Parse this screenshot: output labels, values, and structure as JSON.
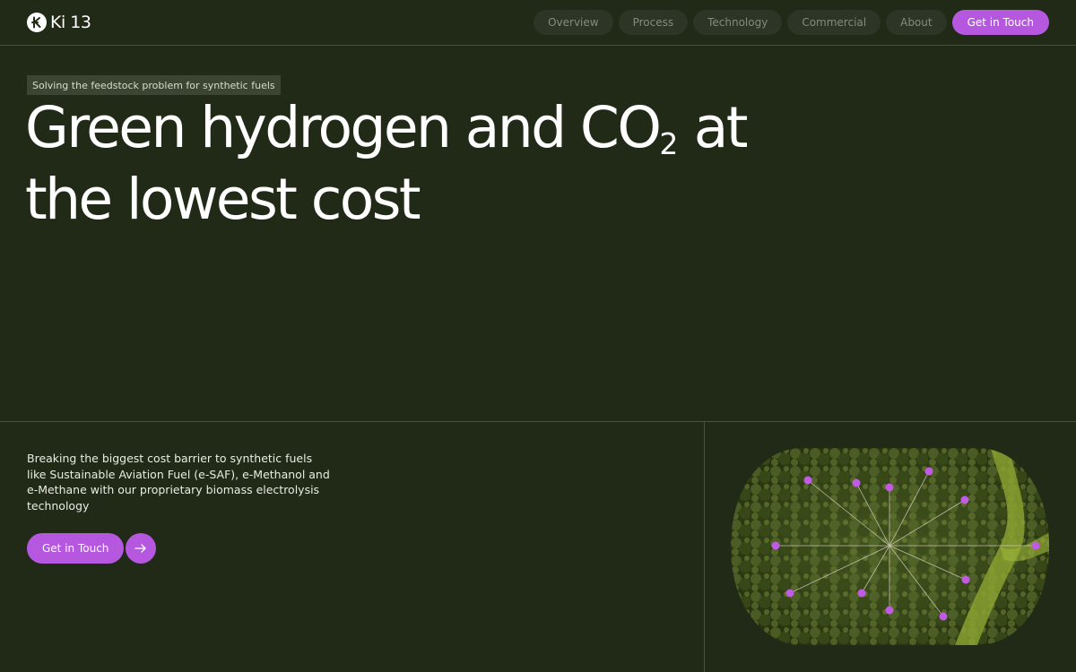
{
  "brand": {
    "name": "Ki 13",
    "logo_icon": "ki-circle-logo"
  },
  "nav": {
    "items": [
      {
        "label": "Overview"
      },
      {
        "label": "Process"
      },
      {
        "label": "Technology"
      },
      {
        "label": "Commercial"
      },
      {
        "label": "About"
      }
    ],
    "cta_label": "Get in Touch"
  },
  "hero": {
    "tagline": "Solving the feedstock problem for synthetic fuels",
    "headline_part1": "Green hydrogen and CO",
    "headline_subscript": "2",
    "headline_part2": " at",
    "headline_line2": "the lowest cost"
  },
  "intro": {
    "description": "Breaking the biggest cost barrier to synthetic fuels like Sustainable Aviation Fuel (e-SAF), e-Methanol and e-Methane with our proprietary biomass electrolysis technology",
    "cta_label": "Get in Touch",
    "cta_icon": "arrow-right-icon"
  },
  "colors": {
    "background": "#202a16",
    "accent": "#b557df",
    "nav_pill": "#2d3526",
    "divider": "#4a5240"
  }
}
